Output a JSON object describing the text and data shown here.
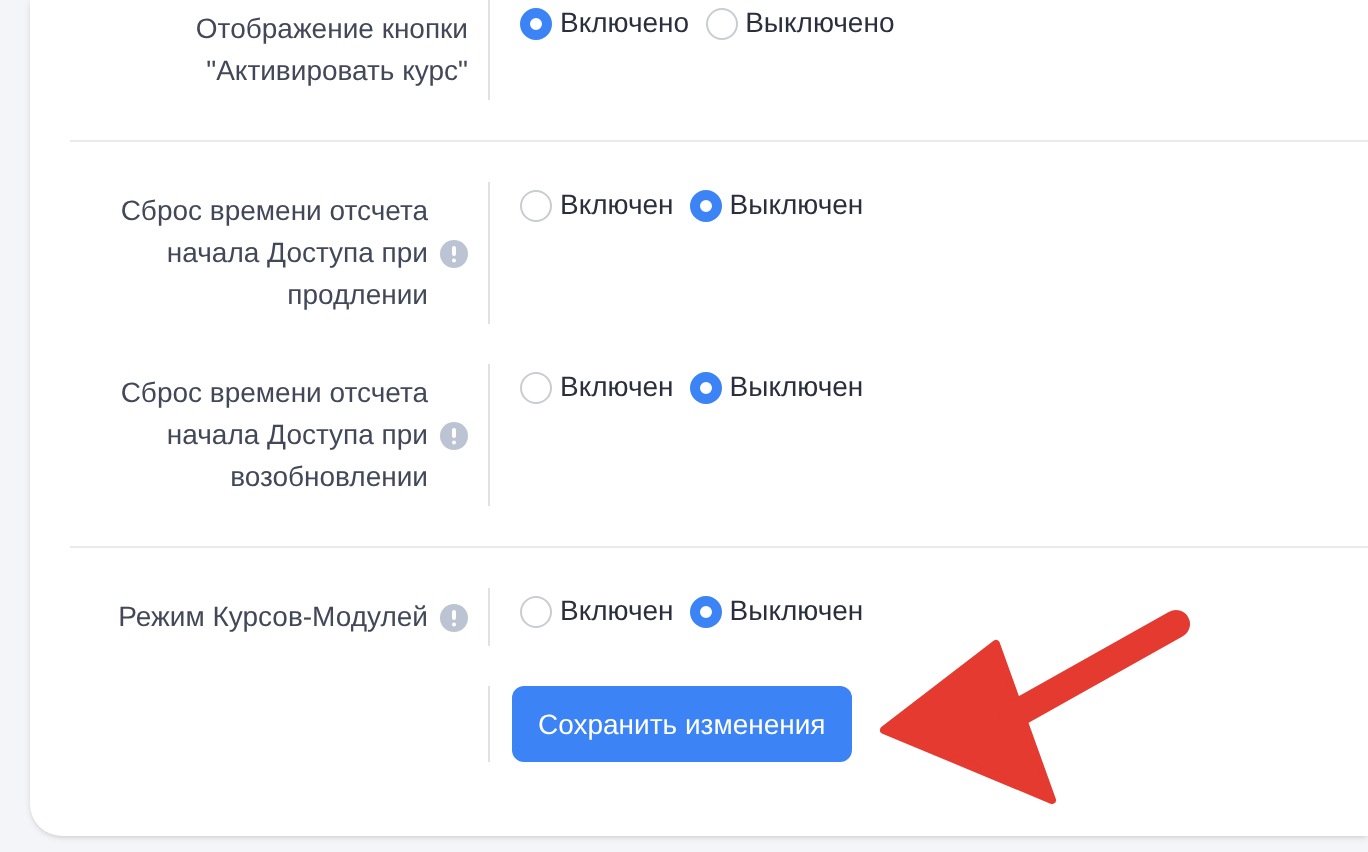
{
  "sections": [
    {
      "rows": [
        {
          "label": "Отображение кнопки \"Активировать курс\"",
          "info": false,
          "options": [
            {
              "label": "Включено",
              "selected": true
            },
            {
              "label": "Выключено",
              "selected": false
            }
          ]
        }
      ]
    },
    {
      "rows": [
        {
          "label": "Сброс времени отсчета начала Доступа при продлении",
          "info": true,
          "options": [
            {
              "label": "Включен",
              "selected": false
            },
            {
              "label": "Выключен",
              "selected": true
            }
          ]
        },
        {
          "label": "Сброс времени отсчета начала Доступа при возобновлении",
          "info": true,
          "options": [
            {
              "label": "Включен",
              "selected": false
            },
            {
              "label": "Выключен",
              "selected": true
            }
          ]
        }
      ]
    },
    {
      "rows": [
        {
          "label": "Режим Курсов-Модулей",
          "info": true,
          "options": [
            {
              "label": "Включен",
              "selected": false
            },
            {
              "label": "Выключен",
              "selected": true
            }
          ]
        }
      ]
    }
  ],
  "save_button": "Сохранить изменения"
}
